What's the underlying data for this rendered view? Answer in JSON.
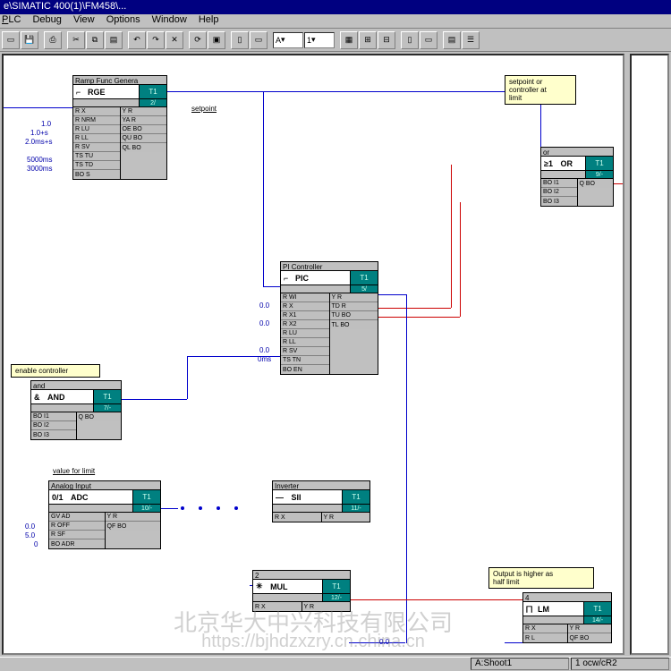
{
  "window": {
    "title": "e\\SIMATIC 400(1)\\FM458\\..."
  },
  "menu": {
    "plc": "PLC",
    "debug": "Debug",
    "view": "View",
    "options": "Options",
    "window": "Window",
    "help": "Help"
  },
  "toolbar": {
    "font": "A",
    "zoom": "1"
  },
  "status": {
    "left": "A:Shoot1",
    "right": "1 ocw/cR2"
  },
  "labels": {
    "setpoint": "setpoint",
    "enable": "enable controller",
    "value_for_limit": "value for limit",
    "limit_note": "setpoint or\ncontroller at\nlimit",
    "output_note": "Output is higher as\nhalf limit"
  },
  "blocks": {
    "rge": {
      "title": "Ramp Func Genera",
      "type": "RGE",
      "tag": "T1",
      "sub": "2/",
      "left": [
        "R  X",
        "R  NRM",
        "R  LU",
        "R  LL",
        "R  SV",
        "TS TU",
        "TS TD",
        "BO S"
      ],
      "right": [
        "Y  R",
        "YA  R",
        "OE BO",
        "QU BO",
        "QL BO"
      ],
      "consts": [
        "1.0",
        "1.0+s",
        "2.0ms+s",
        "",
        "5000ms",
        "3000ms"
      ]
    },
    "pic": {
      "title": "PI Controller",
      "type": "PIC",
      "tag": "T1",
      "sub": "5/",
      "left": [
        "R  WI",
        "R  X",
        "R  X1",
        "R  X2",
        "R  LU",
        "R  LL",
        "R  SV",
        "TS TN",
        "BO EN"
      ],
      "right": [
        "Y  R",
        "TD  R",
        "TU BO",
        "TL BO"
      ],
      "consts": [
        "",
        "0.0",
        "",
        "0.0",
        "",
        "",
        "0.0",
        "0ms"
      ]
    },
    "and": {
      "title": "and",
      "type": "AND",
      "sym": "&",
      "tag": "T1",
      "sub": "7/-",
      "left": [
        "BO I1",
        "BO I2",
        "BO I3"
      ],
      "right": [
        "Q  BO"
      ]
    },
    "or": {
      "title": "or",
      "type": "OR",
      "tag": "T1",
      "sub": "9/-",
      "left": [
        "BO I1",
        "BO I2",
        "BO I3"
      ],
      "right": [
        "Q  BO"
      ]
    },
    "adc": {
      "title": "Analog Input",
      "type": "ADC",
      "sym": "0/1",
      "tag": "T1",
      "sub": "10/-",
      "left": [
        "GV AD",
        "R  OFF",
        "R  SF",
        "BO ADR"
      ],
      "right": [
        "Y  R",
        "QF BO"
      ],
      "consts": [
        "",
        "0.0",
        "5.0",
        "0"
      ]
    },
    "inv": {
      "title": "Inverter",
      "type": "SII",
      "sym": "—",
      "tag": "T1",
      "sub": "11/-",
      "left": [
        "R  X"
      ],
      "right": [
        "Y  R"
      ]
    },
    "mul": {
      "title": "",
      "type": "MUL",
      "sym": "✳",
      "tag": "T1",
      "sub": "12/-",
      "left": [
        "R  X"
      ],
      "right": [
        "Y  R"
      ]
    },
    "lim": {
      "title": "",
      "type": "LM",
      "tag": "T1",
      "sub": "14/-",
      "left": [
        "R  X",
        "R  L"
      ],
      "right": [
        "Y  R",
        "QF BO"
      ],
      "const": "0.0"
    }
  },
  "watermark": {
    "line1": "北京华大中兴科技有限公司",
    "line2": "https://bjhdzxzry.cn.china.cn"
  }
}
